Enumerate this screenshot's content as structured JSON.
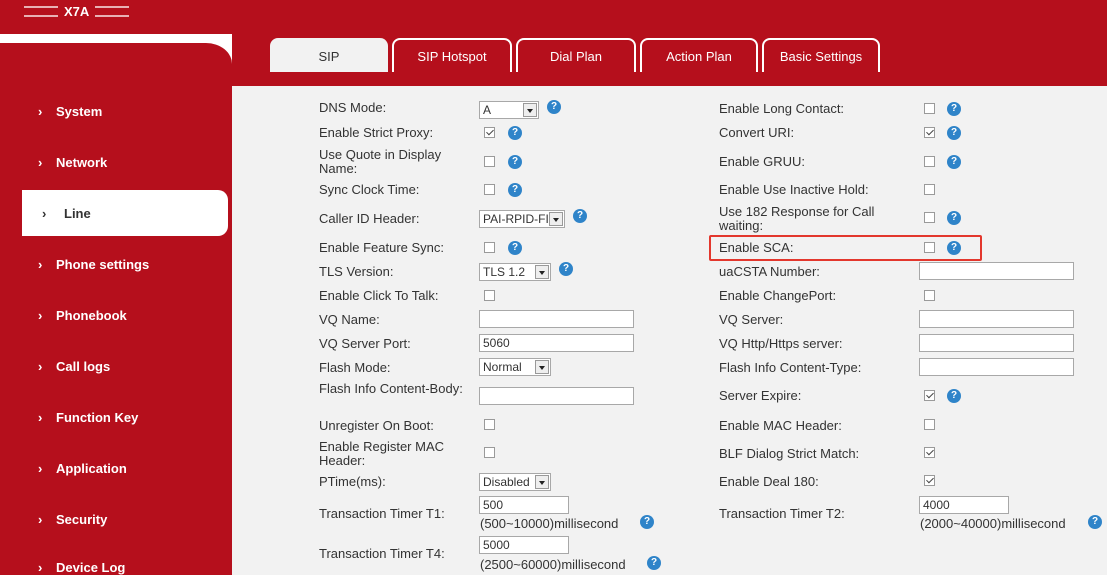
{
  "header": {
    "logo_text": "X7A"
  },
  "sidebar": {
    "items": [
      {
        "label": "System",
        "active": false
      },
      {
        "label": "Network",
        "active": false
      },
      {
        "label": "Line",
        "active": true
      },
      {
        "label": "Phone settings",
        "active": false
      },
      {
        "label": "Phonebook",
        "active": false
      },
      {
        "label": "Call logs",
        "active": false
      },
      {
        "label": "Function Key",
        "active": false
      },
      {
        "label": "Application",
        "active": false
      },
      {
        "label": "Security",
        "active": false
      },
      {
        "label": "Device Log",
        "active": false
      }
    ],
    "arrow": "›"
  },
  "tabs": [
    {
      "label": "SIP",
      "active": true
    },
    {
      "label": "SIP Hotspot",
      "active": false
    },
    {
      "label": "Dial Plan",
      "active": false
    },
    {
      "label": "Action Plan",
      "active": false
    },
    {
      "label": "Basic Settings",
      "active": false
    }
  ],
  "help_icon": "?",
  "left": {
    "dns_mode": {
      "label": "DNS Mode:",
      "value": "A"
    },
    "strict_proxy": {
      "label": "Enable Strict Proxy:",
      "checked": true
    },
    "quote_display": {
      "label": "Use Quote in Display Name:",
      "checked": false
    },
    "sync_clock": {
      "label": "Sync Clock Time:",
      "checked": false
    },
    "caller_id_header": {
      "label": "Caller ID Header:",
      "value": "PAI-RPID-FI"
    },
    "feature_sync": {
      "label": "Enable Feature Sync:",
      "checked": false
    },
    "tls_version": {
      "label": "TLS Version:",
      "value": "TLS 1.2"
    },
    "click_to_talk": {
      "label": "Enable Click To Talk:",
      "checked": false
    },
    "vq_name": {
      "label": "VQ Name:",
      "value": ""
    },
    "vq_server_port": {
      "label": "VQ Server Port:",
      "value": "5060"
    },
    "flash_mode": {
      "label": "Flash Mode:",
      "value": "Normal"
    },
    "flash_body": {
      "label": "Flash Info Content-Body:",
      "value": ""
    },
    "unregister_boot": {
      "label": "Unregister On Boot:",
      "checked": false
    },
    "register_mac": {
      "label": "Enable Register MAC Header:",
      "checked": false
    },
    "ptime": {
      "label": "PTime(ms):",
      "value": "Disabled"
    },
    "timer_t1": {
      "label": "Transaction Timer T1:",
      "value": "500",
      "range": "(500~10000)millisecond"
    },
    "timer_t4": {
      "label": "Transaction Timer T4:",
      "value": "5000",
      "range": "(2500~60000)millisecond"
    }
  },
  "right": {
    "long_contact": {
      "label": "Enable Long Contact:",
      "checked": false
    },
    "convert_uri": {
      "label": "Convert URI:",
      "checked": true
    },
    "gruu": {
      "label": "Enable GRUU:",
      "checked": false
    },
    "inactive_hold": {
      "label": "Enable Use Inactive Hold:",
      "checked": false
    },
    "use_182": {
      "label": "Use 182 Response for Call waiting:",
      "checked": false
    },
    "sca": {
      "label": "Enable SCA:",
      "checked": false
    },
    "uacsta": {
      "label": "uaCSTA Number:",
      "value": ""
    },
    "change_port": {
      "label": "Enable ChangePort:",
      "checked": false
    },
    "vq_server": {
      "label": "VQ Server:",
      "value": ""
    },
    "vq_http": {
      "label": "VQ Http/Https server:",
      "value": ""
    },
    "flash_type": {
      "label": "Flash Info Content-Type:",
      "value": ""
    },
    "server_expire": {
      "label": "Server Expire:",
      "checked": true
    },
    "mac_header": {
      "label": "Enable MAC Header:",
      "checked": false
    },
    "blf_dialog": {
      "label": "BLF Dialog Strict Match:",
      "checked": true
    },
    "deal_180": {
      "label": "Enable Deal 180:",
      "checked": true
    },
    "timer_t2": {
      "label": "Transaction Timer T2:",
      "value": "4000",
      "range": "(2000~40000)millisecond"
    }
  },
  "colors": {
    "brand_red": "#b50f1c",
    "panel_gray": "#f2f2f2",
    "help_blue": "#2f84c9",
    "highlight_red": "#e3372d"
  }
}
